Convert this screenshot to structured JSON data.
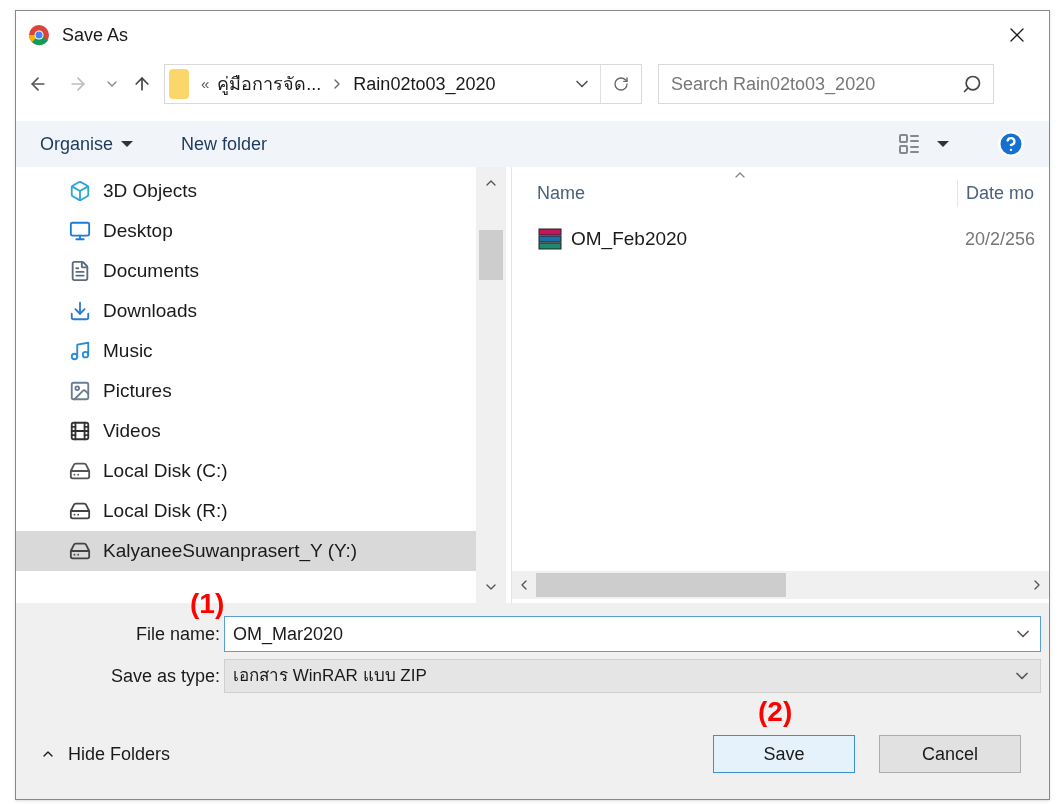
{
  "window": {
    "title": "Save As"
  },
  "address": {
    "overflow": "«",
    "crumbs": [
      "คู่มือการจัด...",
      "Rain02to03_2020"
    ]
  },
  "search": {
    "placeholder": "Search Rain02to03_2020"
  },
  "toolbar": {
    "organise": "Organise",
    "new_folder": "New folder"
  },
  "nav_items": [
    {
      "label": "3D Objects",
      "kind": "objects",
      "selected": false
    },
    {
      "label": "Desktop",
      "kind": "desktop",
      "selected": false
    },
    {
      "label": "Documents",
      "kind": "documents",
      "selected": false
    },
    {
      "label": "Downloads",
      "kind": "downloads",
      "selected": false
    },
    {
      "label": "Music",
      "kind": "music",
      "selected": false
    },
    {
      "label": "Pictures",
      "kind": "pictures",
      "selected": false
    },
    {
      "label": "Videos",
      "kind": "videos",
      "selected": false
    },
    {
      "label": "Local Disk (C:)",
      "kind": "system-drive",
      "selected": false
    },
    {
      "label": "Local Disk (R:)",
      "kind": "drive",
      "selected": false
    },
    {
      "label": "KalyaneeSuwanprasert_Y (Y:)",
      "kind": "drive",
      "selected": true
    }
  ],
  "columns": [
    "Name",
    "Date mo"
  ],
  "files": [
    {
      "name": "OM_Feb2020",
      "date": "20/2/256"
    }
  ],
  "form": {
    "file_name_label": "File name:",
    "file_name": "OM_Mar2020",
    "type_label": "Save as type:",
    "type": "เอกสาร WinRAR แบบ ZIP"
  },
  "annotations": [
    "(1)",
    "(2)"
  ],
  "hide_folders": "Hide Folders",
  "buttons": {
    "save": "Save",
    "cancel": "Cancel"
  }
}
